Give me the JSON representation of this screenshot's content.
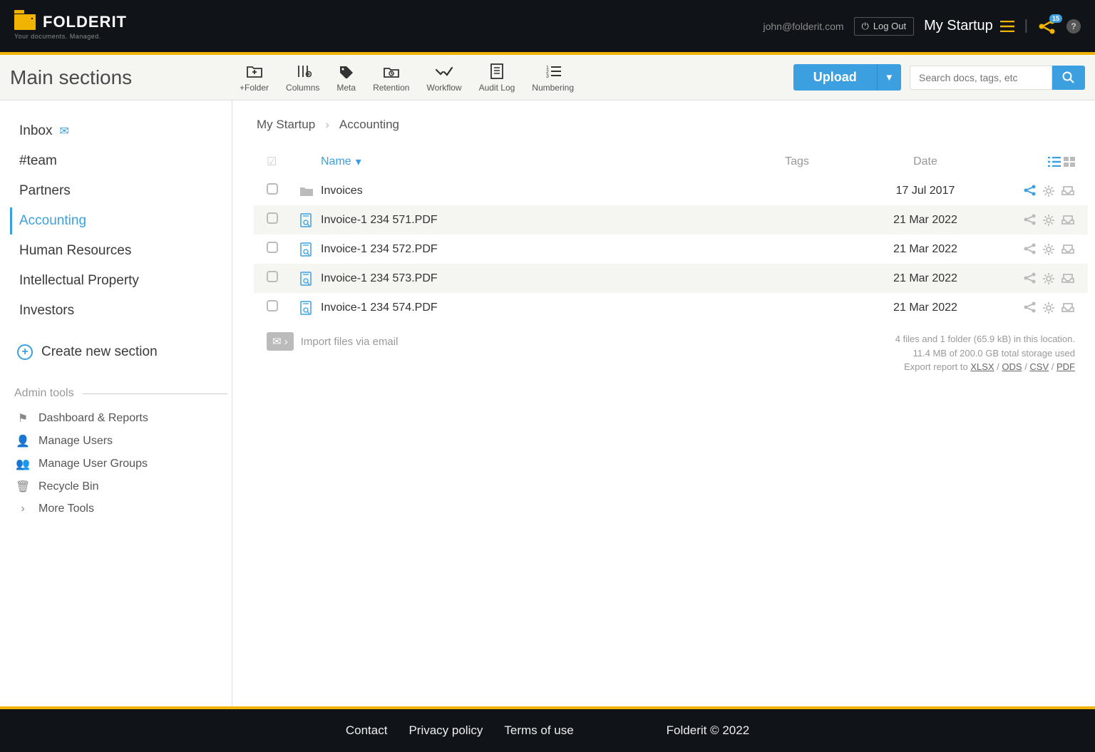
{
  "brand": {
    "name": "FOLDERIT",
    "tagline": "Your documents. Managed."
  },
  "header": {
    "email": "john@folderit.com",
    "logout": "Log Out",
    "account": "My Startup",
    "share_count": "15"
  },
  "toolbar": {
    "title": "Main sections",
    "tools": [
      {
        "label": "+Folder"
      },
      {
        "label": "Columns"
      },
      {
        "label": "Meta"
      },
      {
        "label": "Retention"
      },
      {
        "label": "Workflow"
      },
      {
        "label": "Audit Log"
      },
      {
        "label": "Numbering"
      }
    ],
    "upload": "Upload",
    "search_placeholder": "Search docs, tags, etc"
  },
  "sidebar": {
    "items": [
      {
        "label": "Inbox",
        "mail": true
      },
      {
        "label": "#team"
      },
      {
        "label": "Partners"
      },
      {
        "label": "Accounting",
        "active": true
      },
      {
        "label": "Human Resources"
      },
      {
        "label": "Intellectual Property"
      },
      {
        "label": "Investors"
      }
    ],
    "create": "Create new section",
    "admin_title": "Admin tools",
    "admin": [
      {
        "label": "Dashboard & Reports"
      },
      {
        "label": "Manage Users"
      },
      {
        "label": "Manage User Groups"
      },
      {
        "label": "Recycle Bin"
      },
      {
        "label": "More Tools"
      }
    ]
  },
  "breadcrumbs": {
    "root": "My Startup",
    "current": "Accounting"
  },
  "columns": {
    "name": "Name",
    "tags": "Tags",
    "date": "Date"
  },
  "rows": [
    {
      "name": "Invoices",
      "date": "17 Jul 2017",
      "type": "folder",
      "shared": true
    },
    {
      "name": "Invoice-1 234 571.PDF",
      "date": "21 Mar 2022",
      "type": "pdf"
    },
    {
      "name": "Invoice-1 234 572.PDF",
      "date": "21 Mar 2022",
      "type": "pdf"
    },
    {
      "name": "Invoice-1 234 573.PDF",
      "date": "21 Mar 2022",
      "type": "pdf"
    },
    {
      "name": "Invoice-1 234 574.PDF",
      "date": "21 Mar 2022",
      "type": "pdf"
    }
  ],
  "import_mail": "Import files via email",
  "summary": {
    "line1": "4 files and 1 folder (65.9 kB) in this location.",
    "line2": "11.4 MB of 200.0 GB total storage used",
    "export_prefix": "Export report to ",
    "formats": [
      "XLSX",
      "ODS",
      "CSV",
      "PDF"
    ]
  },
  "footer": {
    "links": [
      "Contact",
      "Privacy policy",
      "Terms of use"
    ],
    "copyright": "Folderit © 2022"
  }
}
